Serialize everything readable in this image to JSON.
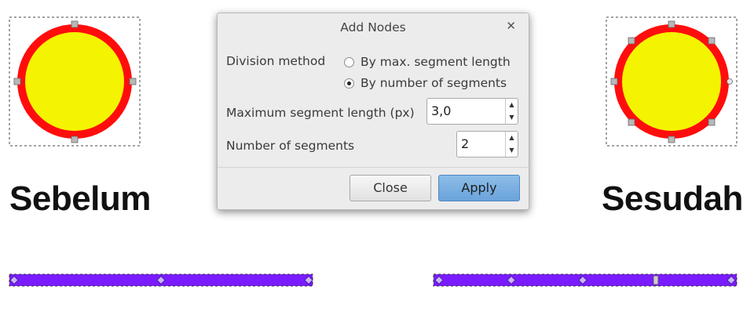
{
  "captions": {
    "before": "Sebelum",
    "after": "Sesudah"
  },
  "colors": {
    "ring": "#ff0d0d",
    "fill": "#f4f400",
    "path": "#7a1cff",
    "node": "#b8b8b8",
    "dialog_bg": "#ececec",
    "apply_bg": "#6aa3db"
  },
  "dialog": {
    "title": "Add Nodes",
    "close_icon": "close-icon",
    "division_method_label": "Division method",
    "options": [
      {
        "label": "By max. segment length",
        "selected": false
      },
      {
        "label": "By number of segments",
        "selected": true
      }
    ],
    "max_segment_label": "Maximum segment length (px)",
    "max_segment_value": "3,0",
    "num_segments_label": "Number of segments",
    "num_segments_value": "2",
    "close_button": "Close",
    "apply_button": "Apply"
  }
}
